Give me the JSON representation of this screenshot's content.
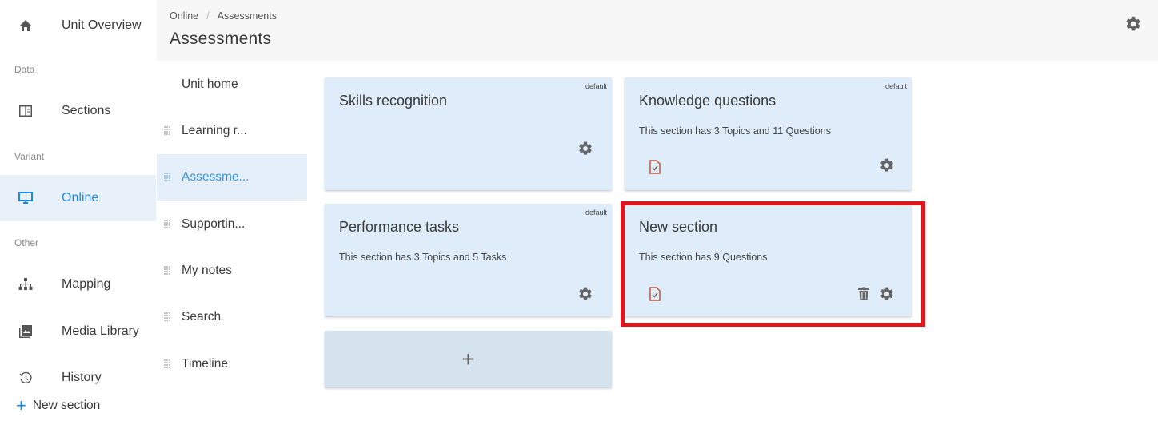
{
  "nav": {
    "unit_overview": "Unit Overview",
    "group_data": "Data",
    "sections": "Sections",
    "group_variant": "Variant",
    "online": "Online",
    "group_other": "Other",
    "mapping": "Mapping",
    "media_library": "Media Library",
    "history": "History"
  },
  "header": {
    "breadcrumb": [
      "Online",
      "/",
      "Assessments"
    ],
    "title": "Assessments"
  },
  "subnav": {
    "items": [
      "Unit home",
      "Learning r...",
      "Assessme...",
      "Supportin...",
      "My notes",
      "Search",
      "Timeline"
    ],
    "new_section": "New section",
    "plus": "+"
  },
  "cards": [
    {
      "title": "Skills recognition",
      "desc": "",
      "badge": "default"
    },
    {
      "title": "Knowledge questions",
      "desc": "This section has 3 Topics and 11 Questions",
      "badge": "default"
    },
    {
      "title": "Performance tasks",
      "desc": "This section has 3 Topics and 5 Tasks",
      "badge": "default"
    },
    {
      "title": "New section",
      "desc": "This section has 9 Questions",
      "badge": ""
    }
  ],
  "add_card": {
    "label": "+"
  },
  "icons": {
    "home": "home-icon",
    "sections": "book-icon",
    "online": "monitor-icon",
    "mapping": "sitemap-icon",
    "media": "image-icon",
    "history": "history-icon",
    "gear": "gear-icon",
    "doc": "document-check-icon",
    "trash": "trash-icon",
    "drag": "drag-handle-icon"
  },
  "colors": {
    "accent": "#1e88e5",
    "card_bg": "#deedf9",
    "highlight": "#e0161e"
  }
}
